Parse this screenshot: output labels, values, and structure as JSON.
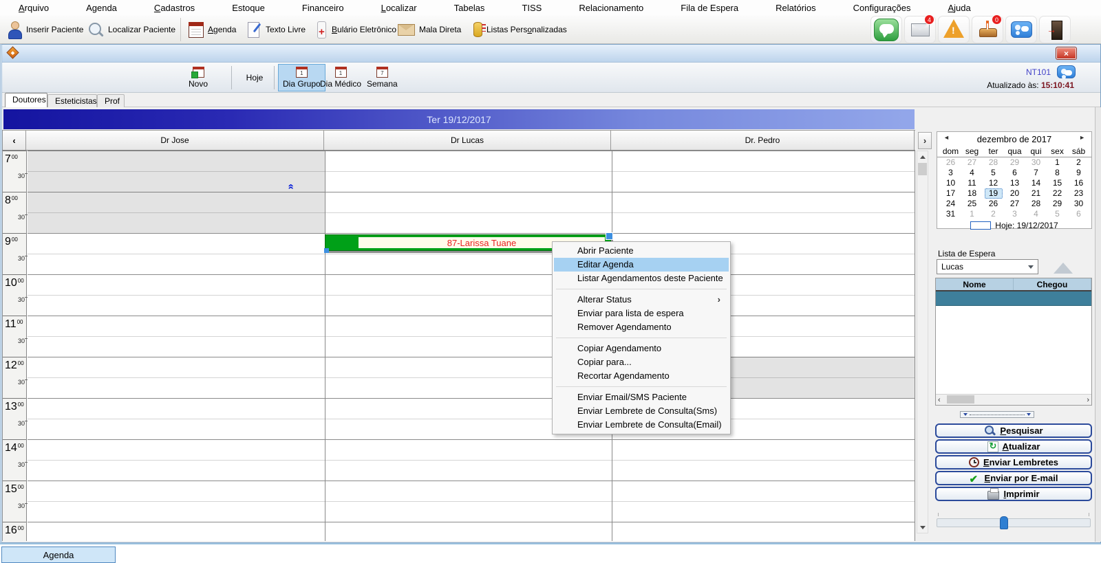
{
  "menubar": {
    "items": [
      {
        "pre": "",
        "key": "A",
        "post": "rquivo"
      },
      {
        "pre": "Agenda",
        "key": "",
        "post": ""
      },
      {
        "pre": "",
        "key": "C",
        "post": "adastros"
      },
      {
        "pre": "Estoque",
        "key": "",
        "post": ""
      },
      {
        "pre": "Financeiro",
        "key": "",
        "post": ""
      },
      {
        "pre": "",
        "key": "L",
        "post": "ocalizar"
      },
      {
        "pre": "Tabelas",
        "key": "",
        "post": ""
      },
      {
        "pre": "TISS",
        "key": "",
        "post": ""
      },
      {
        "pre": "Relacionamento",
        "key": "",
        "post": ""
      },
      {
        "pre": "Fila de Espera",
        "key": "",
        "post": ""
      },
      {
        "pre": "Relatórios",
        "key": "",
        "post": ""
      },
      {
        "pre": "Configurações",
        "key": "",
        "post": ""
      },
      {
        "pre": "",
        "key": "A",
        "post": "juda"
      }
    ]
  },
  "toolbar": {
    "insert_patient": "Inserir Paciente",
    "find_patient": "Localizar Paciente",
    "agenda": {
      "pre": "",
      "key": "A",
      "post": "genda"
    },
    "free_text": "Texto Livre",
    "bulario": {
      "pre": "",
      "key": "B",
      "post": "ulário Eletrônico"
    },
    "mail_merge": "Mala Direta",
    "custom_lists": {
      "pre": "Listas Pers",
      "key": "o",
      "post": "nalizadas"
    },
    "badges": {
      "mail": "4",
      "birthday": "0"
    }
  },
  "window_toolbar": {
    "novo": "Novo",
    "hoje": "Hoje",
    "dia_grupo": "Dia Grupo",
    "dia_medico": "Dia Médico",
    "semana": "Semana"
  },
  "status": {
    "code": "NT101",
    "updated_label": "Atualizado às:",
    "updated_time": "15:10:41"
  },
  "tabs": {
    "doutores": "Doutores",
    "esteticistas": "Esteticistas",
    "prof": "Prof"
  },
  "schedule": {
    "banner": "Ter 19/12/2017",
    "columns": [
      "Dr Jose",
      "Dr Lucas",
      "Dr. Pedro"
    ],
    "hours": [
      7,
      8,
      9,
      10,
      11,
      12,
      13,
      14,
      15,
      16
    ],
    "minute_full": "00",
    "minute_half": "30",
    "appointment": {
      "label": "87-Larissa Tuane",
      "column": "Dr Lucas",
      "start": "09:00"
    },
    "blocked": [
      {
        "column": "Dr Jose",
        "from": "07:00",
        "to": "09:00"
      },
      {
        "column": "Dr. Pedro",
        "from": "12:00",
        "to": "13:00"
      }
    ]
  },
  "context_menu": {
    "items": [
      {
        "label": "Abrir Paciente"
      },
      {
        "label": "Editar Agenda",
        "highlighted": true
      },
      {
        "label": "Listar Agendamentos deste Paciente"
      },
      {
        "label": "Alterar Status",
        "submenu": true
      },
      {
        "label": "Enviar para lista de espera"
      },
      {
        "label": "Remover Agendamento"
      },
      {
        "label": "Copiar Agendamento"
      },
      {
        "label": "Copiar para..."
      },
      {
        "label": "Recortar Agendamento"
      },
      {
        "label": "Enviar Email/SMS Paciente"
      },
      {
        "label": "Enviar Lembrete de Consulta(Sms)"
      },
      {
        "label": "Enviar Lembrete de Consulta(Email)"
      }
    ]
  },
  "mini_calendar": {
    "title": "dezembro de 2017",
    "weekdays": [
      "dom",
      "seg",
      "ter",
      "qua",
      "qui",
      "sex",
      "sáb"
    ],
    "weeks": [
      [
        26,
        27,
        28,
        29,
        30,
        1,
        2
      ],
      [
        3,
        4,
        5,
        6,
        7,
        8,
        9
      ],
      [
        10,
        11,
        12,
        13,
        14,
        15,
        16
      ],
      [
        17,
        18,
        19,
        20,
        21,
        22,
        23
      ],
      [
        24,
        25,
        26,
        27,
        28,
        29,
        30
      ],
      [
        31,
        1,
        2,
        3,
        4,
        5,
        6
      ]
    ],
    "selected_day": 19,
    "today_label": "Hoje: 19/12/2017"
  },
  "waitlist": {
    "title": "Lista de Espera",
    "selected_professional": "Lucas",
    "columns": [
      "Nome",
      "Chegou"
    ]
  },
  "actions": {
    "pesquisar": {
      "pre": "",
      "key": "P",
      "post": "esquisar"
    },
    "atualizar": {
      "pre": "",
      "key": "A",
      "post": "tualizar"
    },
    "lembretes": {
      "pre": "",
      "key": "E",
      "post": "nviar Lembretes"
    },
    "email": {
      "pre": "",
      "key": "E",
      "post": "nviar por E-mail"
    },
    "imprimir": {
      "pre": "",
      "key": "I",
      "post": "mprimir"
    }
  },
  "bottom": {
    "tab": "Agenda"
  },
  "glyphs": {
    "prev": "‹",
    "next": "›",
    "cal_prev": "◄",
    "cal_next": "►",
    "submenu": "›",
    "double_up": "»",
    "close": "×",
    "day_one": "1",
    "day_seven": "7"
  },
  "colors": {
    "appointment_green": "#00a018",
    "appointment_text": "#e82020",
    "banner_left": "#1414a0",
    "banner_right": "#93a7ea",
    "menu_highlight": "#a6d1f2",
    "waitlist_selected_row": "#3e7f9b"
  }
}
